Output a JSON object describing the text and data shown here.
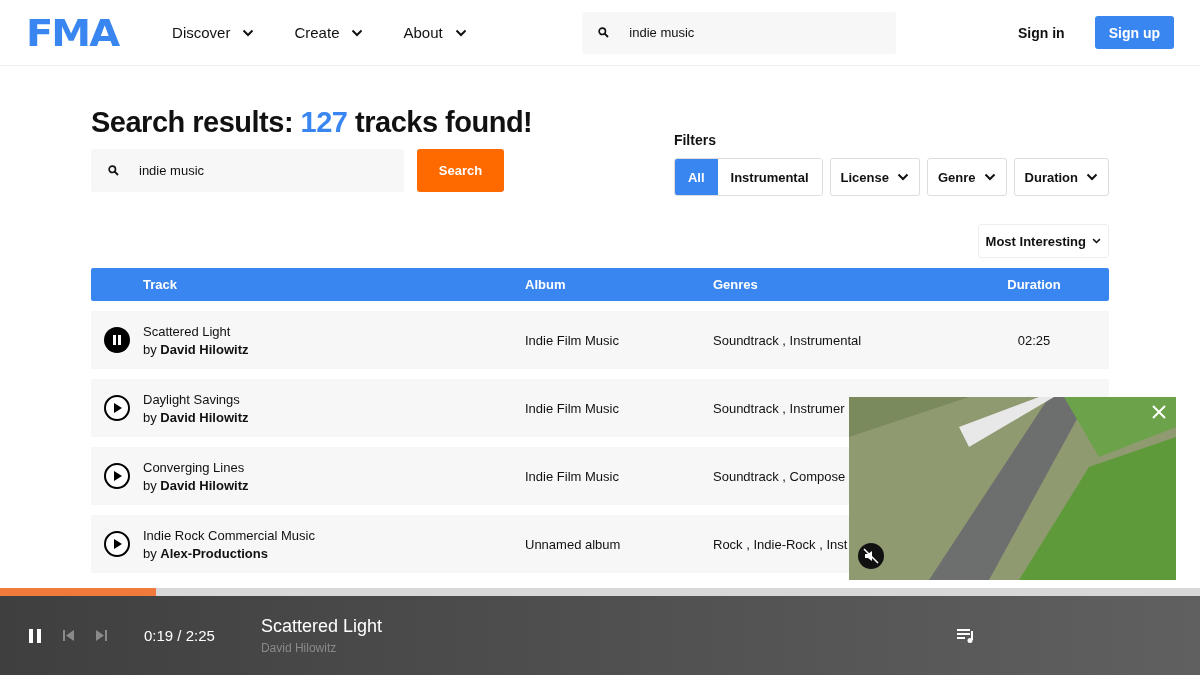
{
  "header": {
    "logo": "FMA",
    "nav": [
      {
        "label": "Discover"
      },
      {
        "label": "Create"
      },
      {
        "label": "About"
      }
    ],
    "search": {
      "value": "indie music"
    },
    "sign_in": "Sign in",
    "sign_up": "Sign up"
  },
  "results": {
    "title_prefix": "Search results:",
    "count": "127",
    "title_suffix": "tracks found!",
    "search": {
      "value": "indie music"
    },
    "search_button": "Search"
  },
  "filters": {
    "label": "Filters",
    "options": [
      {
        "label": "All",
        "selected": true
      },
      {
        "label": "Instrumental",
        "selected": false
      }
    ],
    "dropdowns": [
      "License",
      "Genre",
      "Duration"
    ]
  },
  "sort": {
    "label": "Most Interesting"
  },
  "table": {
    "columns": [
      "Track",
      "Album",
      "Genres",
      "Duration"
    ],
    "rows": [
      {
        "playing": true,
        "title": "Scattered Light",
        "artist": "by **David Hilowitz**",
        "album": "Indie Film Music",
        "genres": "Soundtrack , Instrumental",
        "duration": "02:25"
      },
      {
        "playing": false,
        "title": "Daylight Savings",
        "artist": "by **David Hilowitz**",
        "album": "Indie Film Music",
        "genres": "Soundtrack , Instrumer",
        "duration": ""
      },
      {
        "playing": false,
        "title": "Converging Lines",
        "artist": "by **David Hilowitz**",
        "album": "Indie Film Music",
        "genres": "Soundtrack , Compose",
        "duration": ""
      },
      {
        "playing": false,
        "title": "Indie Rock Commercial Music",
        "artist": "by **Alex-Productions**",
        "album": "Unnamed album",
        "genres": "Rock , Indie-Rock , Inst",
        "duration": ""
      }
    ]
  },
  "video": {
    "muted": true
  },
  "player": {
    "playing": true,
    "level": 0.13,
    "time": "0:19 / 2:25",
    "title": "Scattered Light",
    "artist": "David Hilowitz"
  }
}
